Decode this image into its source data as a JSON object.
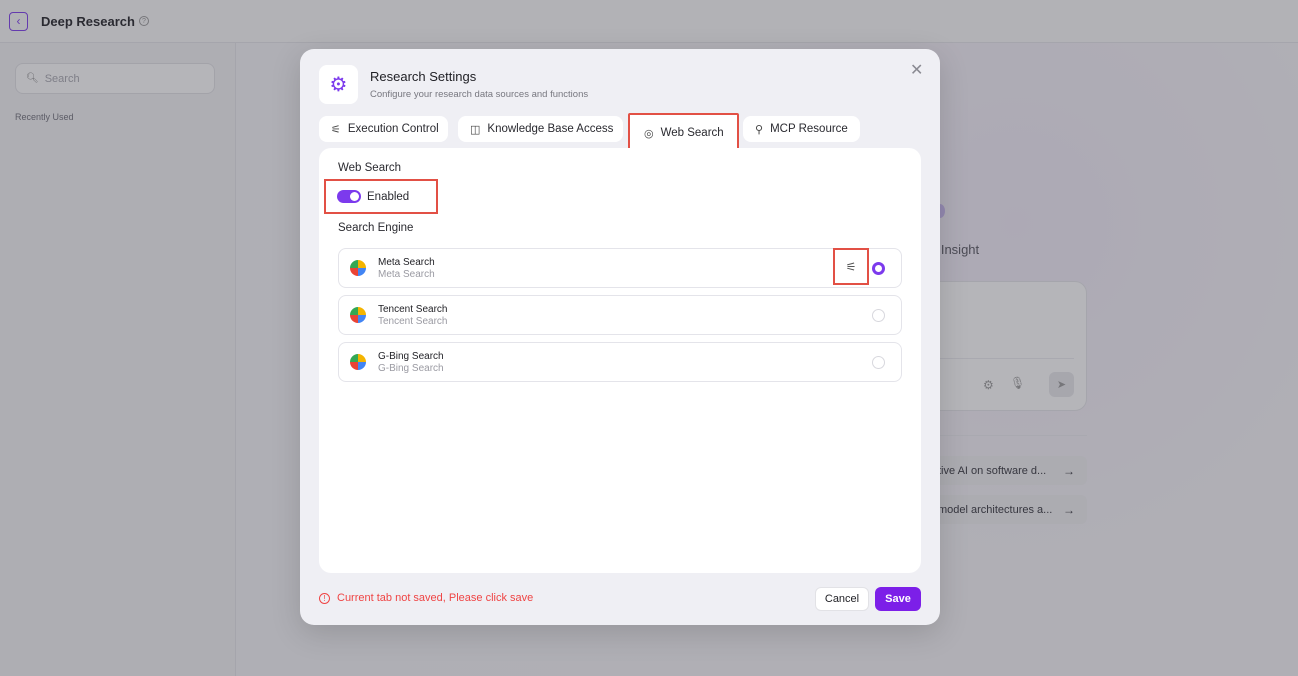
{
  "app": {
    "title": "Deep Research",
    "back_icon": "chevron-left-icon",
    "help_icon": "question-circle-icon"
  },
  "sidebar": {
    "search_placeholder": "Search",
    "recently_used_label": "Recently Used"
  },
  "background": {
    "insight_text": "o Insight",
    "suggestions": [
      {
        "text": "tive AI on software d..."
      },
      {
        "text": "model architectures a..."
      }
    ]
  },
  "modal": {
    "title": "Research Settings",
    "subtitle": "Configure your research data sources and functions",
    "icon": "gear-icon",
    "close_icon": "close-icon",
    "tabs": [
      {
        "label": "Execution Control",
        "icon": "sliders-icon"
      },
      {
        "label": "Knowledge Base Access",
        "icon": "database-icon"
      },
      {
        "label": "Web Search",
        "icon": "globe-icon",
        "active": true
      },
      {
        "label": "MCP Resource",
        "icon": "plug-icon"
      }
    ],
    "web_search": {
      "label": "Web Search",
      "toggle_label": "Enabled",
      "enabled": true,
      "engine_section_label": "Search Engine",
      "engines": [
        {
          "name": "Meta Search",
          "subtitle": "Meta Search",
          "selected": true
        },
        {
          "name": "Tencent Search",
          "subtitle": "Tencent Search",
          "selected": false
        },
        {
          "name": "G-Bing Search",
          "subtitle": "G-Bing Search",
          "selected": false
        }
      ]
    },
    "footer": {
      "warning": "Current tab not saved, Please click save",
      "cancel_label": "Cancel",
      "save_label": "Save"
    }
  },
  "colors": {
    "accent": "#7c3aed",
    "save": "#7c1fe8",
    "highlight": "#e25045",
    "warning": "#ef4444"
  }
}
